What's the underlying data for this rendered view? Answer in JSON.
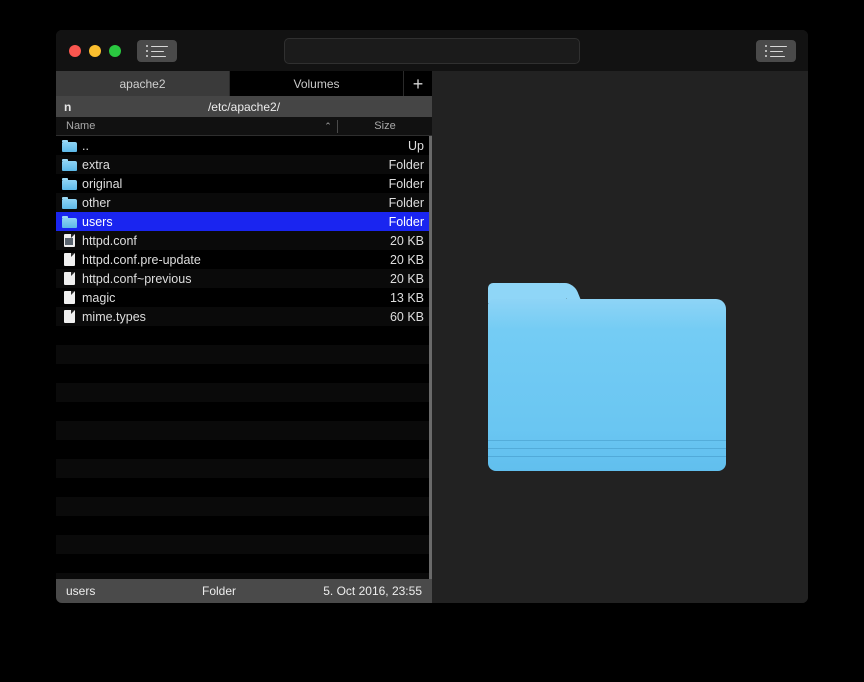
{
  "window": {
    "traffic_lights": [
      "close",
      "minimize",
      "zoom"
    ],
    "colors": {
      "selection_blue": "#1a25f0",
      "folder_blue": "#74ccf4",
      "folder_tab_blue": "#8fd6f7",
      "window_bg": "#222222",
      "titlebar_bg": "#121212",
      "pathbar_bg": "#454545"
    }
  },
  "toolbar": {
    "left_view_button_icon": "list-view-icon",
    "right_view_button_icon": "list-view-icon",
    "search": {
      "value": "",
      "placeholder": ""
    }
  },
  "tabs": {
    "items": [
      {
        "label": "apache2",
        "active": true
      },
      {
        "label": "Volumes",
        "active": false
      }
    ],
    "add_label": "+"
  },
  "pathbar": {
    "drive_label": "n",
    "path": "/etc/apache2/"
  },
  "columns": {
    "name": "Name",
    "size": "Size",
    "sort_indicator": "⌃"
  },
  "files": [
    {
      "name": "..",
      "size": "Up",
      "icon": "folder-icon",
      "selected": false
    },
    {
      "name": "extra",
      "size": "Folder",
      "icon": "folder-icon",
      "selected": false
    },
    {
      "name": "original",
      "size": "Folder",
      "icon": "folder-icon",
      "selected": false
    },
    {
      "name": "other",
      "size": "Folder",
      "icon": "folder-icon",
      "selected": false
    },
    {
      "name": "users",
      "size": "Folder",
      "icon": "folder-icon",
      "selected": true
    },
    {
      "name": "httpd.conf",
      "size": "20 KB",
      "icon": "document-preview-icon",
      "selected": false
    },
    {
      "name": "httpd.conf.pre-update",
      "size": "20 KB",
      "icon": "document-icon",
      "selected": false
    },
    {
      "name": "httpd.conf~previous",
      "size": "20 KB",
      "icon": "document-icon",
      "selected": false
    },
    {
      "name": "magic",
      "size": "13 KB",
      "icon": "document-icon",
      "selected": false
    },
    {
      "name": "mime.types",
      "size": "60 KB",
      "icon": "document-icon",
      "selected": false
    }
  ],
  "statusbar": {
    "name": "users",
    "type": "Folder",
    "date": "5. Oct 2016, 23:55"
  },
  "preview": {
    "icon": "large-folder-icon"
  }
}
